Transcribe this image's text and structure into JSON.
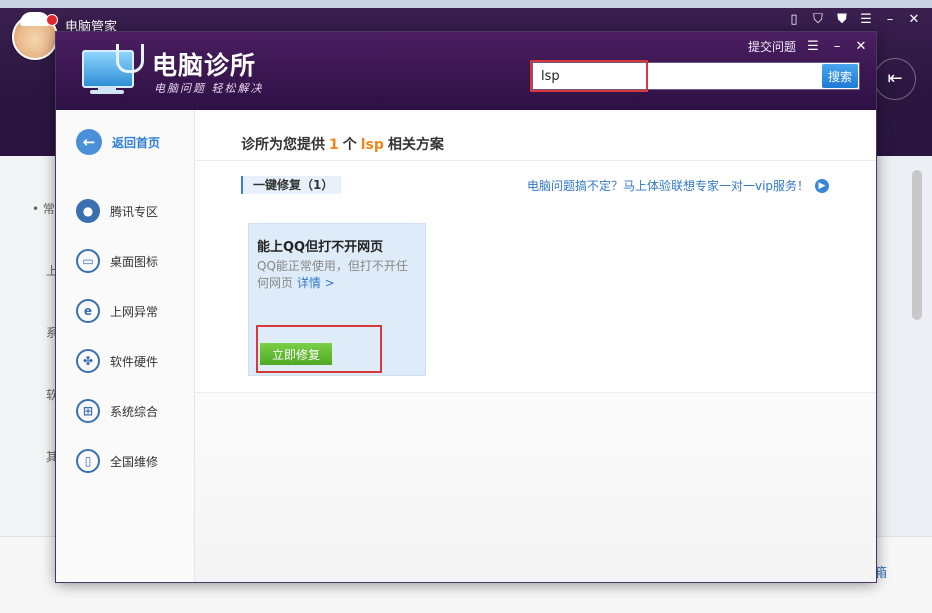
{
  "background_app": {
    "title": "电脑管家",
    "exit_icon": "exit-icon",
    "left_nav_fragments": [
      "• 常",
      "上",
      "系",
      "软",
      "其"
    ],
    "footer_fragment": "箱"
  },
  "dialog": {
    "brand": "电脑诊所",
    "slogan": "电脑问题 轻松解决",
    "submit_issue": "提交问题",
    "search": {
      "value": "lsp",
      "button_label": "搜索"
    },
    "sidebar": {
      "back_label": "返回首页",
      "items": [
        {
          "label": "腾讯专区",
          "icon": "penguin-icon"
        },
        {
          "label": "桌面图标",
          "icon": "desktop-icon"
        },
        {
          "label": "上网异常",
          "icon": "ie-icon"
        },
        {
          "label": "软件硬件",
          "icon": "hardware-icon"
        },
        {
          "label": "系统综合",
          "icon": "windows-icon"
        },
        {
          "label": "全国维修",
          "icon": "repair-icon"
        }
      ]
    },
    "result": {
      "prefix": "诊所为您提供",
      "count": "1",
      "unit": "个",
      "keyword": "lsp",
      "suffix": "相关方案"
    },
    "section_label": "一键修复（1）",
    "promo_text": "电脑问题搞不定？马上体验联想专家一对一vip服务！",
    "card": {
      "title": "能上QQ但打不开网页",
      "desc": "QQ能正常使用，但打不开任何网页",
      "detail_link": "详情 >",
      "fix_button": "立即修复"
    }
  },
  "colors": {
    "header_purple": "#3a1650",
    "accent_blue": "#2f7ed6",
    "highlight_orange": "#f08519",
    "fix_green": "#4ea823",
    "annotation_red": "#d6393a"
  }
}
